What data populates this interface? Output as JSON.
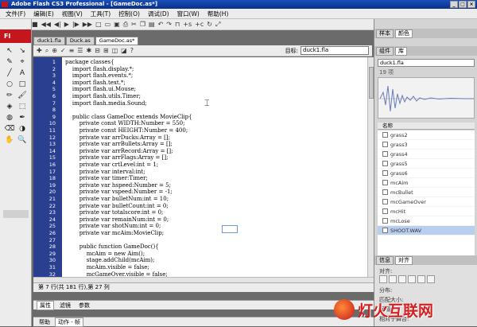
{
  "window": {
    "title": "Adobe Flash CS3 Professional - [GameDoc.as*]",
    "controls": [
      "_",
      "□",
      "×"
    ]
  },
  "menu": [
    "文件(F)",
    "编辑(E)",
    "视图(V)",
    "工具(T)",
    "控制(O)",
    "调试(D)",
    "窗口(W)",
    "帮助(H)"
  ],
  "tools_panel": {
    "label": "Fl",
    "tools": [
      "↖",
      "↘",
      "✎",
      "⌖",
      "╱",
      "A",
      "○",
      "□",
      "✏",
      "🖌",
      "◈",
      "⬚",
      "◍",
      "✒",
      "⌫",
      "◑",
      "✋",
      "🔍"
    ]
  },
  "doc_tabs": [
    {
      "label": "duck1.fla",
      "active": false
    },
    {
      "label": "Duck.as",
      "active": false
    },
    {
      "label": "GameDoc.as*",
      "active": true
    }
  ],
  "editor_toolbar": {
    "target_label": "目标:",
    "target_value": "duck1.fla"
  },
  "code_lines": [
    {
      "n": "1",
      "t": "package classes{"
    },
    {
      "n": "2",
      "t": "    import flash.display.*;"
    },
    {
      "n": "3",
      "t": "    import flash.events.*;"
    },
    {
      "n": "4",
      "t": "    import flash.text.*;"
    },
    {
      "n": "5",
      "t": "    import flash.ui.Mouse;"
    },
    {
      "n": "6",
      "t": "    import flash.utils.Timer;"
    },
    {
      "n": "7",
      "t": "    import flash.media.Sound;"
    },
    {
      "n": "8",
      "t": ""
    },
    {
      "n": "9",
      "t": "    public class GameDoc extends MovieClip{"
    },
    {
      "n": "10",
      "t": "        private const WIDTH:Number = 550;"
    },
    {
      "n": "11",
      "t": "        private const HEIGHT:Number = 400;"
    },
    {
      "n": "12",
      "t": "        private var arrDucks:Array = [];"
    },
    {
      "n": "13",
      "t": "        private var arrBullets:Array = [];"
    },
    {
      "n": "14",
      "t": "        private var arrRecord:Array = [];"
    },
    {
      "n": "15",
      "t": "        private var arrFlags:Array = [];"
    },
    {
      "n": "16",
      "t": "        private var crtLevel:int = 1;"
    },
    {
      "n": "17",
      "t": "        private var interval:int;"
    },
    {
      "n": "18",
      "t": "        private var timer:Timer;"
    },
    {
      "n": "19",
      "t": "        private var hspeed:Number = 5;"
    },
    {
      "n": "20",
      "t": "        private var vspeed:Number = -1;"
    },
    {
      "n": "21",
      "t": "        private var bulletNum:int = 10;"
    },
    {
      "n": "22",
      "t": "        private var bulletCount:int = 0;"
    },
    {
      "n": "23",
      "t": "        private var totalscore:int = 0;"
    },
    {
      "n": "24",
      "t": "        private var remainNum:int = 0;"
    },
    {
      "n": "25",
      "t": "        private var shotNum:int = 0;"
    },
    {
      "n": "26",
      "t": "        private var mcAim:MovieClip;"
    },
    {
      "n": "27",
      "t": ""
    },
    {
      "n": "28",
      "t": "        public function GameDoc(){"
    },
    {
      "n": "29",
      "t": "            mcAim = new Aim();"
    },
    {
      "n": "30",
      "t": "            stage.addChild(mcAim);"
    },
    {
      "n": "31",
      "t": "            mcAim.visible = false;"
    },
    {
      "n": "32",
      "t": "            mcGameOver.visible = false;"
    }
  ],
  "status": "第 7 行(共 181 行),第 27 列",
  "properties_tabs": [
    "属性",
    "滤镜",
    "参数"
  ],
  "help_tabs": [
    "帮助",
    "动作 - 帧"
  ],
  "right_panel": {
    "top_tabs": [
      "样本",
      "颜色"
    ],
    "lib_tabs": [
      "组件",
      "库"
    ],
    "library_select": "duck1.fla",
    "item_count": "19 项",
    "column_name": "名称",
    "items": [
      {
        "name": "grass2",
        "selected": false
      },
      {
        "name": "grass3",
        "selected": false
      },
      {
        "name": "grass4",
        "selected": false
      },
      {
        "name": "grass5",
        "selected": false
      },
      {
        "name": "grass6",
        "selected": false
      },
      {
        "name": "mcAim",
        "selected": false
      },
      {
        "name": "mcBullet",
        "selected": false
      },
      {
        "name": "mcGameOver",
        "selected": false
      },
      {
        "name": "mcHit",
        "selected": false
      },
      {
        "name": "mcLose",
        "selected": false
      },
      {
        "name": "SHOOT.WAV",
        "selected": true
      }
    ],
    "bottom_tabs": [
      "信息",
      "对齐"
    ],
    "align_labels": [
      "对齐:",
      "分布:",
      "匹配大小:",
      "间隔:",
      "相对于舞台:"
    ]
  },
  "watermark": "灯火互联网"
}
